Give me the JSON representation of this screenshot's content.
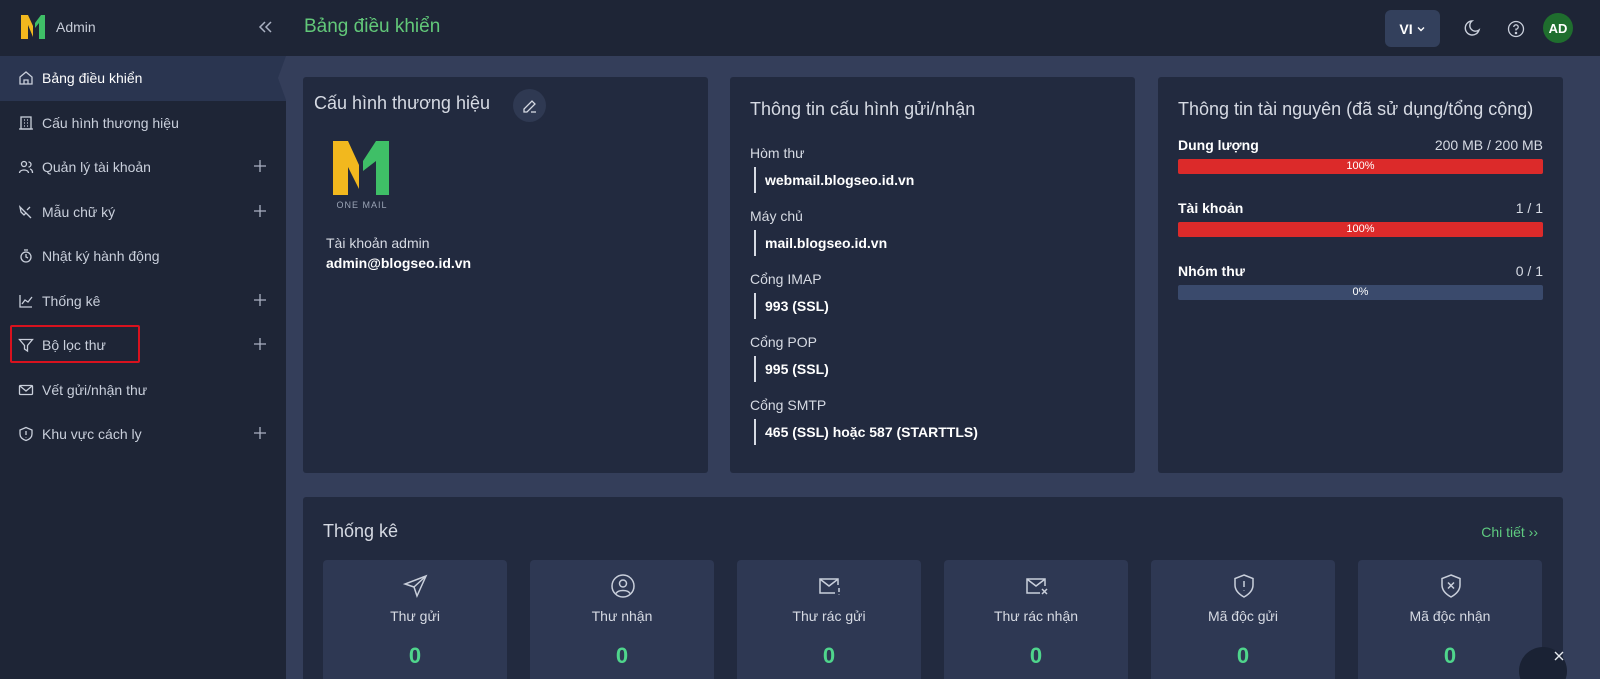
{
  "app": {
    "title": "Admin"
  },
  "sidebar": {
    "items": [
      {
        "label": "Bảng điều khiển",
        "icon": "home-icon",
        "expandable": false,
        "active": true
      },
      {
        "label": "Cấu hình thương hiệu",
        "icon": "building-icon",
        "expandable": false
      },
      {
        "label": "Quản lý tài khoản",
        "icon": "users-icon",
        "expandable": true
      },
      {
        "label": "Mẫu chữ ký",
        "icon": "signature-icon",
        "expandable": true
      },
      {
        "label": "Nhật ký hành động",
        "icon": "activity-log-icon",
        "expandable": false
      },
      {
        "label": "Thống kê",
        "icon": "chart-icon",
        "expandable": true
      },
      {
        "label": "Bộ lọc thư",
        "icon": "filter-icon",
        "expandable": true,
        "highlighted": true
      },
      {
        "label": "Vết gửi/nhận thư",
        "icon": "mail-trace-icon",
        "expandable": false
      },
      {
        "label": "Khu vực cách ly",
        "icon": "shield-icon",
        "expandable": true
      }
    ]
  },
  "header": {
    "title": "Bảng điều khiển",
    "language": "VI",
    "avatar_initials": "AD"
  },
  "brand_card": {
    "title": "Cấu hình thương hiệu",
    "logo_text": "ONE MAIL",
    "account_label": "Tài khoản admin",
    "account_value": "admin@blogseo.id.vn"
  },
  "config_card": {
    "title": "Thông tin cấu hình gửi/nhận",
    "fields": [
      {
        "label": "Hòm thư",
        "value": "webmail.blogseo.id.vn"
      },
      {
        "label": "Máy chủ",
        "value": "mail.blogseo.id.vn"
      },
      {
        "label": "Cổng IMAP",
        "value": "993 (SSL)"
      },
      {
        "label": "Cổng POP",
        "value": "995 (SSL)"
      },
      {
        "label": "Cổng SMTP",
        "value": "465 (SSL) hoặc 587 (STARTTLS)"
      }
    ]
  },
  "resource_card": {
    "title": "Thông tin tài nguyên (đã sử dụng/tổng cộng)",
    "items": [
      {
        "name": "Dung lượng",
        "amount": "200 MB / 200 MB",
        "percent_text": "100%",
        "fraction": 1.0
      },
      {
        "name": "Tài khoản",
        "amount": "1 / 1",
        "percent_text": "100%",
        "fraction": 1.0
      },
      {
        "name": "Nhóm thư",
        "amount": "0 / 1",
        "percent_text": "0%",
        "fraction": 0.0
      }
    ]
  },
  "stats": {
    "title": "Thống kê",
    "detail_link": "Chi tiết ››",
    "tiles": [
      {
        "label": "Thư gửi",
        "value": "0",
        "icon": "send-icon"
      },
      {
        "label": "Thư nhận",
        "value": "0",
        "icon": "user-circle-icon"
      },
      {
        "label": "Thư rác gửi",
        "value": "0",
        "icon": "mail-alert-icon"
      },
      {
        "label": "Thư rác nhận",
        "value": "0",
        "icon": "mail-x-icon"
      },
      {
        "label": "Mã độc gửi",
        "value": "0",
        "icon": "shield-alert-icon"
      },
      {
        "label": "Mã độc nhận",
        "value": "0",
        "icon": "shield-x-icon"
      }
    ]
  },
  "colors": {
    "accent_green": "#62c879",
    "value_green": "#4fd58c",
    "progress_red": "#dc2a2a",
    "highlight_red": "#d8121e",
    "logo_yellow": "#f2b81e"
  }
}
